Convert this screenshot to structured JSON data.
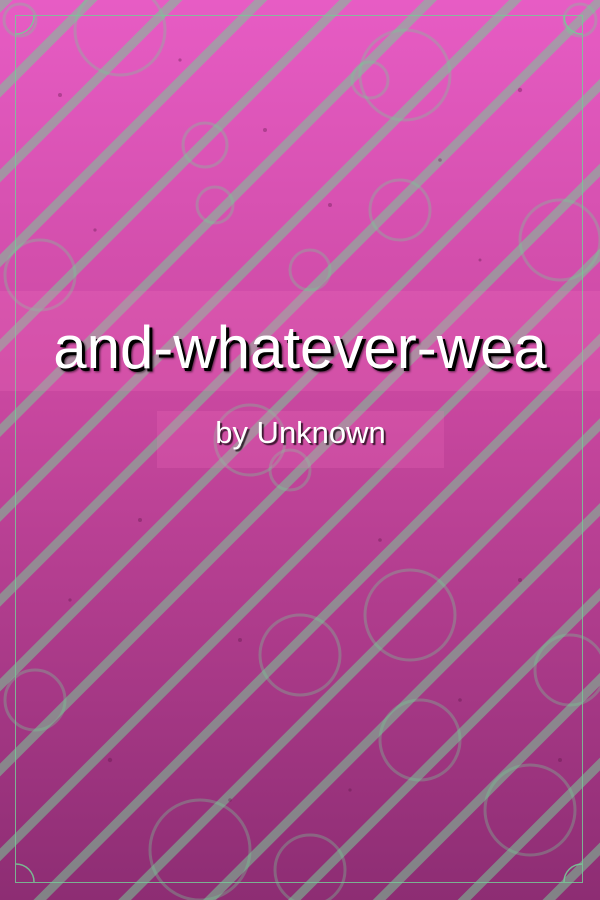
{
  "cover": {
    "title": "and-whatever-wea",
    "author": "by Unknown"
  },
  "colors": {
    "background_top": "#e75cc4",
    "background_bottom": "#8d2d73",
    "stripe": "#7ec89a",
    "frame": "#78c896",
    "title_text": "#ffffff",
    "title_shadow": "#000000"
  }
}
